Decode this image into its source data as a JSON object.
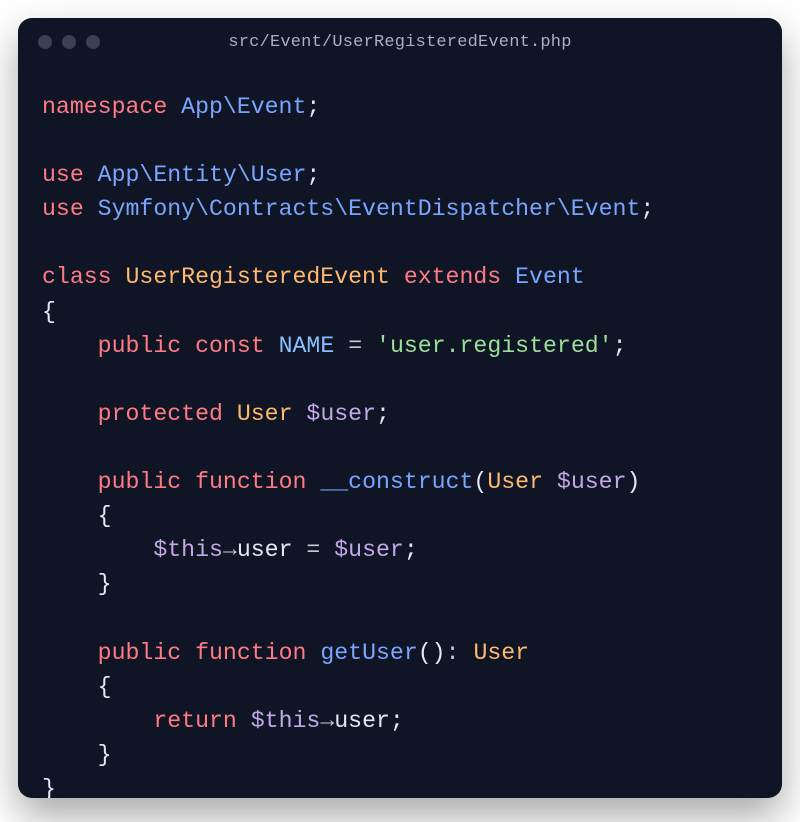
{
  "window": {
    "title": "src/Event/UserRegisteredEvent.php"
  },
  "code": {
    "kw_namespace": "namespace",
    "ns_path": "App\\Event",
    "kw_use": "use",
    "use1": "App\\Entity\\User",
    "use2": "Symfony\\Contracts\\EventDispatcher\\Event",
    "kw_class": "class",
    "class_name": "UserRegisteredEvent",
    "kw_extends": "extends",
    "base_class": "Event",
    "kw_public": "public",
    "kw_const": "const",
    "const_name": "NAME",
    "const_value": "'user.registered'",
    "kw_protected": "protected",
    "type_user": "User",
    "var_user": "$user",
    "kw_function": "function",
    "fn_construct": "__construct",
    "var_this": "$this",
    "prop_user": "user",
    "fn_getUser": "getUser",
    "kw_return": "return",
    "semicolon": ";",
    "eq": "=",
    "arrow": "→",
    "colon": ":",
    "lparen": "(",
    "rparen": ")",
    "lbrace": "{",
    "rbrace": "}"
  }
}
